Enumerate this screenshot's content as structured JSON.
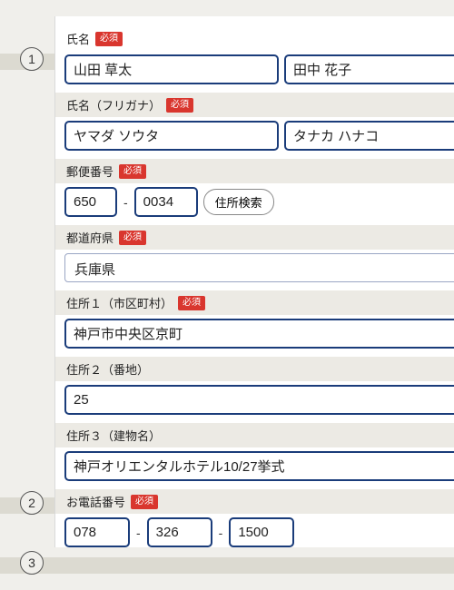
{
  "callouts": {
    "c1": "1",
    "c2": "2",
    "c3": "3"
  },
  "badges": {
    "required": "必須"
  },
  "fields": {
    "name": {
      "label": "氏名",
      "required": true,
      "last": "山田 草太",
      "first": "田中 花子"
    },
    "kana": {
      "label": "氏名（フリガナ）",
      "required": true,
      "last": "ヤマダ ソウタ",
      "first": "タナカ ハナコ"
    },
    "postal": {
      "label": "郵便番号",
      "required": true,
      "zip1": "650",
      "zip2": "0034",
      "lookup": "住所検索"
    },
    "pref": {
      "label": "都道府県",
      "required": true,
      "value": "兵庫県"
    },
    "addr1": {
      "label": "住所１（市区町村）",
      "required": true,
      "value": "神戸市中央区京町"
    },
    "addr2": {
      "label": "住所２（番地）",
      "required": false,
      "value": "25"
    },
    "addr3": {
      "label": "住所３（建物名）",
      "required": false,
      "value": "神戸オリエンタルホテル10/27挙式"
    },
    "tel": {
      "label": "お電話番号",
      "required": true,
      "p1": "078",
      "p2": "326",
      "p3": "1500"
    }
  }
}
